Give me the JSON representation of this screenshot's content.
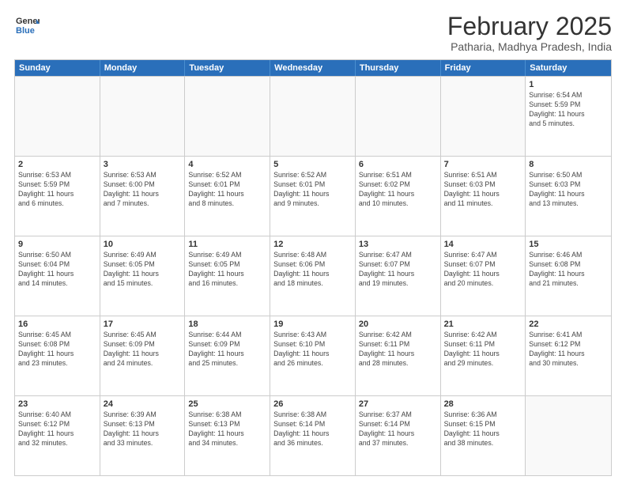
{
  "logo": {
    "general": "General",
    "blue": "Blue"
  },
  "header": {
    "month_year": "February 2025",
    "location": "Patharia, Madhya Pradesh, India"
  },
  "weekdays": [
    "Sunday",
    "Monday",
    "Tuesday",
    "Wednesday",
    "Thursday",
    "Friday",
    "Saturday"
  ],
  "rows": [
    [
      {
        "day": "",
        "info": ""
      },
      {
        "day": "",
        "info": ""
      },
      {
        "day": "",
        "info": ""
      },
      {
        "day": "",
        "info": ""
      },
      {
        "day": "",
        "info": ""
      },
      {
        "day": "",
        "info": ""
      },
      {
        "day": "1",
        "info": "Sunrise: 6:54 AM\nSunset: 5:59 PM\nDaylight: 11 hours\nand 5 minutes."
      }
    ],
    [
      {
        "day": "2",
        "info": "Sunrise: 6:53 AM\nSunset: 5:59 PM\nDaylight: 11 hours\nand 6 minutes."
      },
      {
        "day": "3",
        "info": "Sunrise: 6:53 AM\nSunset: 6:00 PM\nDaylight: 11 hours\nand 7 minutes."
      },
      {
        "day": "4",
        "info": "Sunrise: 6:52 AM\nSunset: 6:01 PM\nDaylight: 11 hours\nand 8 minutes."
      },
      {
        "day": "5",
        "info": "Sunrise: 6:52 AM\nSunset: 6:01 PM\nDaylight: 11 hours\nand 9 minutes."
      },
      {
        "day": "6",
        "info": "Sunrise: 6:51 AM\nSunset: 6:02 PM\nDaylight: 11 hours\nand 10 minutes."
      },
      {
        "day": "7",
        "info": "Sunrise: 6:51 AM\nSunset: 6:03 PM\nDaylight: 11 hours\nand 11 minutes."
      },
      {
        "day": "8",
        "info": "Sunrise: 6:50 AM\nSunset: 6:03 PM\nDaylight: 11 hours\nand 13 minutes."
      }
    ],
    [
      {
        "day": "9",
        "info": "Sunrise: 6:50 AM\nSunset: 6:04 PM\nDaylight: 11 hours\nand 14 minutes."
      },
      {
        "day": "10",
        "info": "Sunrise: 6:49 AM\nSunset: 6:05 PM\nDaylight: 11 hours\nand 15 minutes."
      },
      {
        "day": "11",
        "info": "Sunrise: 6:49 AM\nSunset: 6:05 PM\nDaylight: 11 hours\nand 16 minutes."
      },
      {
        "day": "12",
        "info": "Sunrise: 6:48 AM\nSunset: 6:06 PM\nDaylight: 11 hours\nand 18 minutes."
      },
      {
        "day": "13",
        "info": "Sunrise: 6:47 AM\nSunset: 6:07 PM\nDaylight: 11 hours\nand 19 minutes."
      },
      {
        "day": "14",
        "info": "Sunrise: 6:47 AM\nSunset: 6:07 PM\nDaylight: 11 hours\nand 20 minutes."
      },
      {
        "day": "15",
        "info": "Sunrise: 6:46 AM\nSunset: 6:08 PM\nDaylight: 11 hours\nand 21 minutes."
      }
    ],
    [
      {
        "day": "16",
        "info": "Sunrise: 6:45 AM\nSunset: 6:08 PM\nDaylight: 11 hours\nand 23 minutes."
      },
      {
        "day": "17",
        "info": "Sunrise: 6:45 AM\nSunset: 6:09 PM\nDaylight: 11 hours\nand 24 minutes."
      },
      {
        "day": "18",
        "info": "Sunrise: 6:44 AM\nSunset: 6:09 PM\nDaylight: 11 hours\nand 25 minutes."
      },
      {
        "day": "19",
        "info": "Sunrise: 6:43 AM\nSunset: 6:10 PM\nDaylight: 11 hours\nand 26 minutes."
      },
      {
        "day": "20",
        "info": "Sunrise: 6:42 AM\nSunset: 6:11 PM\nDaylight: 11 hours\nand 28 minutes."
      },
      {
        "day": "21",
        "info": "Sunrise: 6:42 AM\nSunset: 6:11 PM\nDaylight: 11 hours\nand 29 minutes."
      },
      {
        "day": "22",
        "info": "Sunrise: 6:41 AM\nSunset: 6:12 PM\nDaylight: 11 hours\nand 30 minutes."
      }
    ],
    [
      {
        "day": "23",
        "info": "Sunrise: 6:40 AM\nSunset: 6:12 PM\nDaylight: 11 hours\nand 32 minutes."
      },
      {
        "day": "24",
        "info": "Sunrise: 6:39 AM\nSunset: 6:13 PM\nDaylight: 11 hours\nand 33 minutes."
      },
      {
        "day": "25",
        "info": "Sunrise: 6:38 AM\nSunset: 6:13 PM\nDaylight: 11 hours\nand 34 minutes."
      },
      {
        "day": "26",
        "info": "Sunrise: 6:38 AM\nSunset: 6:14 PM\nDaylight: 11 hours\nand 36 minutes."
      },
      {
        "day": "27",
        "info": "Sunrise: 6:37 AM\nSunset: 6:14 PM\nDaylight: 11 hours\nand 37 minutes."
      },
      {
        "day": "28",
        "info": "Sunrise: 6:36 AM\nSunset: 6:15 PM\nDaylight: 11 hours\nand 38 minutes."
      },
      {
        "day": "",
        "info": ""
      }
    ]
  ]
}
